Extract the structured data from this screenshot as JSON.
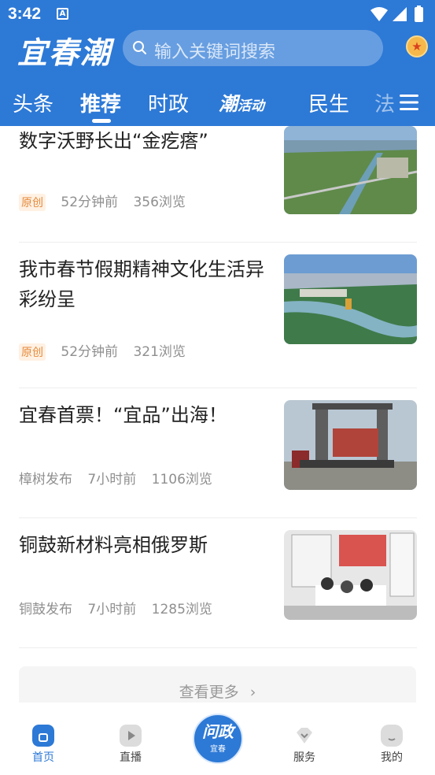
{
  "status_bar": {
    "time": "3:42",
    "notification_letter": "A"
  },
  "header": {
    "logo_text": "宜春潮",
    "search_placeholder": "输入关键词搜索",
    "coin_symbol": "★"
  },
  "tabs": [
    {
      "label": "头条",
      "active": false
    },
    {
      "label": "推荐",
      "active": true
    },
    {
      "label": "时政",
      "active": false
    },
    {
      "label": "潮",
      "sub": "活动",
      "active": false
    },
    {
      "label": "民生",
      "active": false
    },
    {
      "label": "法",
      "active": false
    }
  ],
  "feed": [
    {
      "title": "数字沃野长出“金疙瘩”",
      "badge": "原创",
      "source": "",
      "time": "52分钟前",
      "views": "356浏览"
    },
    {
      "title": "我市春节假期精神文化生活异彩纷呈",
      "badge": "原创",
      "source": "",
      "time": "52分钟前",
      "views": "321浏览"
    },
    {
      "title": "宜春首票！“宜品”出海！",
      "badge": "",
      "source": "樟树发布",
      "time": "7小时前",
      "views": "1106浏览"
    },
    {
      "title": "铜鼓新材料亮相俄罗斯",
      "badge": "",
      "source": "铜鼓发布",
      "time": "7小时前",
      "views": "1285浏览"
    }
  ],
  "load_more": {
    "label": "查看更多",
    "chevron": "›"
  },
  "bottom_nav": {
    "items": [
      {
        "label": "首页",
        "icon": "home-icon",
        "active": true
      },
      {
        "label": "直播",
        "icon": "play-icon",
        "active": false
      },
      {
        "label": "服务",
        "icon": "diamond-icon",
        "active": false
      },
      {
        "label": "我的",
        "icon": "profile-icon",
        "active": false
      }
    ],
    "center": {
      "title": "问政",
      "subtitle": "宜春"
    }
  },
  "colors": {
    "brand": "#2d79d6",
    "badge": "#e58a3c",
    "meta": "#8f8f8f"
  }
}
